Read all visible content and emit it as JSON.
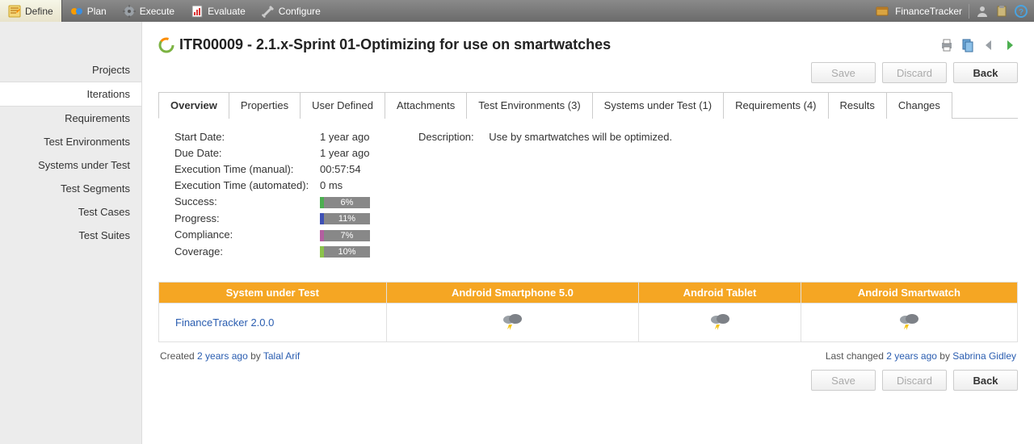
{
  "topMenu": {
    "items": [
      {
        "label": "Define",
        "active": true
      },
      {
        "label": "Plan"
      },
      {
        "label": "Execute"
      },
      {
        "label": "Evaluate"
      },
      {
        "label": "Configure"
      }
    ],
    "project": "FinanceTracker"
  },
  "sidebar": {
    "items": [
      {
        "label": "Projects"
      },
      {
        "label": "Iterations",
        "active": true
      },
      {
        "label": "Requirements"
      },
      {
        "label": "Test Environments"
      },
      {
        "label": "Systems under Test"
      },
      {
        "label": "Test Segments"
      },
      {
        "label": "Test Cases"
      },
      {
        "label": "Test Suites"
      }
    ]
  },
  "page": {
    "title": "ITR00009 - 2.1.x-Sprint 01-Optimizing for use on smartwatches",
    "buttons": {
      "save": "Save",
      "discard": "Discard",
      "back": "Back"
    }
  },
  "tabs": [
    {
      "label": "Overview",
      "active": true
    },
    {
      "label": "Properties"
    },
    {
      "label": "User Defined"
    },
    {
      "label": "Attachments"
    },
    {
      "label": "Test Environments (3)"
    },
    {
      "label": "Systems under Test (1)"
    },
    {
      "label": "Requirements (4)"
    },
    {
      "label": "Results"
    },
    {
      "label": "Changes"
    }
  ],
  "overview": {
    "startDateLabel": "Start Date:",
    "startDate": "1 year ago",
    "dueDateLabel": "Due Date:",
    "dueDate": "1 year ago",
    "execManualLabel": "Execution Time (manual):",
    "execManual": "00:57:54",
    "execAutoLabel": "Execution Time (automated):",
    "execAuto": "0 ms",
    "successLabel": "Success:",
    "successPct": "6%",
    "successColor": "#4caf50",
    "progressLabel": "Progress:",
    "progressPct": "11%",
    "progressColor": "#3f51b5",
    "complianceLabel": "Compliance:",
    "compliancePct": "7%",
    "complianceColor": "#b35fa0",
    "coverageLabel": "Coverage:",
    "coveragePct": "10%",
    "coverageColor": "#8bc34a",
    "descriptionLabel": "Description:",
    "description": "Use by smartwatches will be optimized."
  },
  "sutTable": {
    "headers": [
      "System under Test",
      "Android Smartphone 5.0",
      "Android Tablet",
      "Android Smartwatch"
    ],
    "row": {
      "name": "FinanceTracker 2.0.0"
    }
  },
  "meta": {
    "createdPrefix": "Created ",
    "createdTime": "2 years ago",
    "createdByPrefix": " by ",
    "createdBy": "Talal Arif",
    "changedPrefix": "Last changed ",
    "changedTime": "2 years ago",
    "changedByPrefix": " by ",
    "changedBy": "Sabrina Gidley"
  }
}
